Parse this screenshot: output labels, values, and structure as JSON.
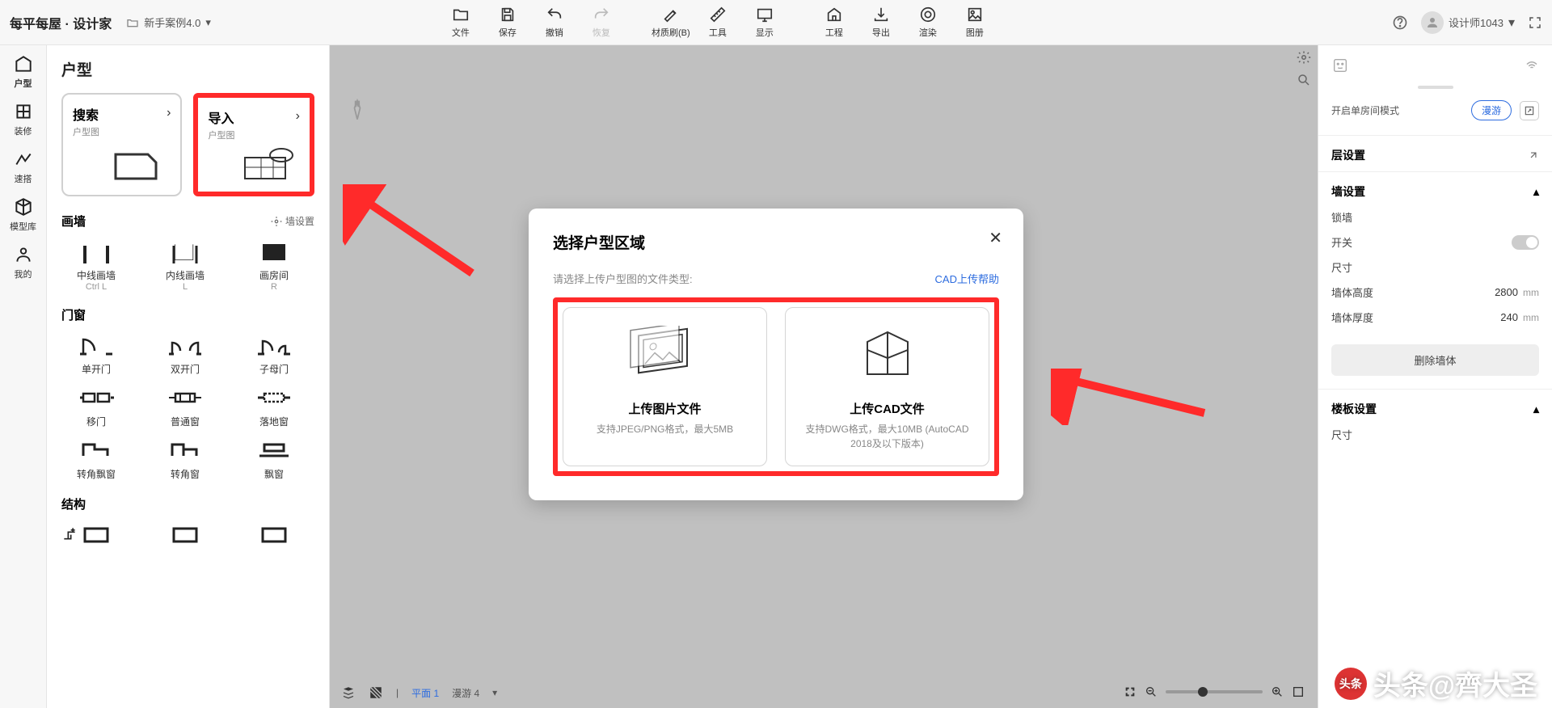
{
  "header": {
    "logo": "每平每屋 · 设计家",
    "project": "新手案例4.0",
    "tools": [
      {
        "label": "文件",
        "icon": "folder"
      },
      {
        "label": "保存",
        "icon": "save"
      },
      {
        "label": "撤销",
        "icon": "undo"
      },
      {
        "label": "恢复",
        "icon": "redo",
        "disabled": true
      },
      {
        "gap": true
      },
      {
        "label": "材质刷(B)",
        "icon": "brush"
      },
      {
        "label": "工具",
        "icon": "ruler"
      },
      {
        "label": "显示",
        "icon": "display"
      },
      {
        "gap": true
      },
      {
        "label": "工程",
        "icon": "project"
      },
      {
        "label": "导出",
        "icon": "export"
      },
      {
        "label": "渲染",
        "icon": "render"
      },
      {
        "label": "图册",
        "icon": "album"
      }
    ],
    "help_icon": "help",
    "user": "设计师1043"
  },
  "rail": [
    {
      "label": "户型",
      "active": true
    },
    {
      "label": "装修"
    },
    {
      "label": "速搭"
    },
    {
      "label": "模型库"
    },
    {
      "label": "我的"
    }
  ],
  "leftPanel": {
    "title": "户型",
    "cards": [
      {
        "title": "搜索",
        "sub": "户型图"
      },
      {
        "title": "导入",
        "sub": "户型图",
        "highlight": true
      }
    ],
    "sections": [
      {
        "title": "画墙",
        "link": "墙设置",
        "items": [
          {
            "label": "中线画墙",
            "sub": "Ctrl L"
          },
          {
            "label": "内线画墙",
            "sub": "L"
          },
          {
            "label": "画房间",
            "sub": "R"
          }
        ]
      },
      {
        "title": "门窗",
        "items": [
          {
            "label": "单开门"
          },
          {
            "label": "双开门"
          },
          {
            "label": "子母门"
          },
          {
            "label": "移门"
          },
          {
            "label": "普通窗"
          },
          {
            "label": "落地窗"
          },
          {
            "label": "转角飘窗"
          },
          {
            "label": "转角窗"
          },
          {
            "label": "飘窗"
          }
        ]
      },
      {
        "title": "结构",
        "items": [
          {
            "label": ""
          },
          {
            "label": ""
          },
          {
            "label": ""
          }
        ]
      }
    ]
  },
  "canvas": {
    "bottom": {
      "plane": "平面 1",
      "roam": "漫游 4"
    }
  },
  "rightPanel": {
    "modeLabel": "开启单房间模式",
    "roamBtn": "漫游",
    "secLayer": "层设置",
    "secWall": "墙设置",
    "lock": "锁墙",
    "switch": "开关",
    "size": "尺寸",
    "height": "墙体高度",
    "heightVal": "2800",
    "thick": "墙体厚度",
    "thickVal": "240",
    "unit": "mm",
    "delBtn": "删除墙体",
    "secFloor": "楼板设置",
    "floorSize": "尺寸"
  },
  "modal": {
    "title": "选择户型区域",
    "sub": "请选择上传户型图的文件类型:",
    "help": "CAD上传帮助",
    "options": [
      {
        "title": "上传图片文件",
        "sub": "支持JPEG/PNG格式，最大5MB"
      },
      {
        "title": "上传CAD文件",
        "sub": "支持DWG格式，最大10MB (AutoCAD 2018及以下版本)"
      }
    ]
  },
  "watermark": "头条@齊大圣"
}
